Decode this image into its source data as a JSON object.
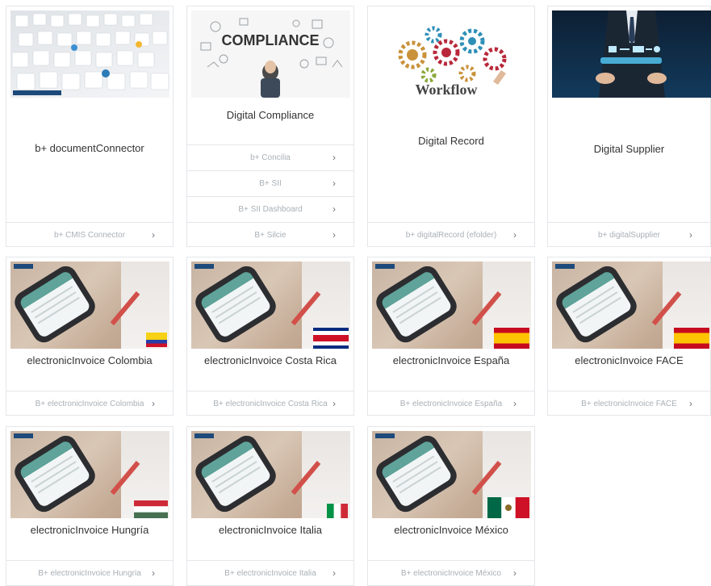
{
  "cards": [
    {
      "title": "b+ documentConnector",
      "links": [
        {
          "label": "b+ CMIS Connector"
        }
      ]
    },
    {
      "title": "Digital Compliance",
      "image_text": "COMPLIANCE",
      "links": [
        {
          "label": "b+ Concilia"
        },
        {
          "label": "B+ SII"
        },
        {
          "label": "B+ SII Dashboard"
        },
        {
          "label": "B+ Silcie"
        }
      ]
    },
    {
      "title": "Digital Record",
      "image_text": "Workflow",
      "links": [
        {
          "label": "b+ digitalRecord (efolder)"
        }
      ]
    },
    {
      "title": "Digital Supplier",
      "links": [
        {
          "label": "b+ digitalSupplier"
        }
      ]
    },
    {
      "title": "electronicInvoice Colombia",
      "links": [
        {
          "label": "B+ electronicInvoice Colombia"
        }
      ]
    },
    {
      "title": "electronicInvoice Costa Rica",
      "links": [
        {
          "label": "B+ electronicInvoice Costa Rica"
        }
      ]
    },
    {
      "title": "electronicInvoice España",
      "links": [
        {
          "label": "B+ electronicInvoice España"
        }
      ]
    },
    {
      "title": "electronicInvoice FACE",
      "links": [
        {
          "label": "B+ electronicInvoice FACE"
        }
      ]
    },
    {
      "title": "electronicInvoice Hungría",
      "links": [
        {
          "label": "B+ electronicInvoice Hungria"
        }
      ]
    },
    {
      "title": "electronicInvoice Italia",
      "links": [
        {
          "label": "B+ electronicInvoice Italia"
        }
      ]
    },
    {
      "title": "electronicInvoice México",
      "links": [
        {
          "label": "B+ electronicInvoice México"
        }
      ]
    }
  ],
  "icons": {
    "chevron": "chevron-right-icon"
  },
  "colors": {
    "border": "#e3e6ea",
    "link_text": "#a9b0b6",
    "title_text": "#333333"
  }
}
